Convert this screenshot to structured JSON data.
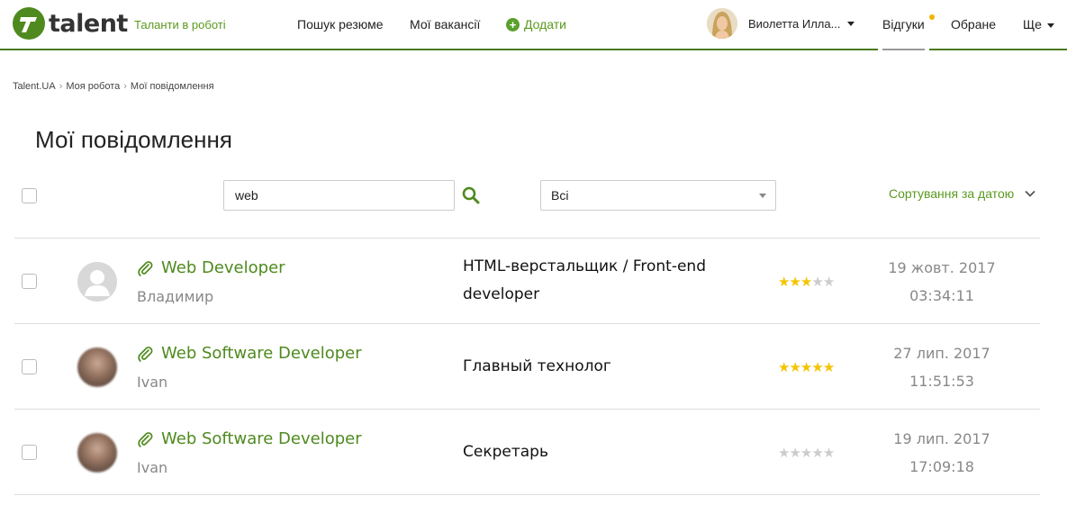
{
  "header": {
    "logo_text": "talent",
    "tagline": "Таланти в роботі",
    "nav": {
      "search_resumes": "Пошук резюме",
      "my_vacancies": "Мої вакансії",
      "add": "Додати"
    },
    "user_name": "Виолетта Илла...",
    "responses": "Відгуки",
    "favorites": "Обране",
    "more": "Ще"
  },
  "breadcrumb": [
    "Talent.UA",
    "Моя робота",
    "Мої повідомлення"
  ],
  "page_title": "Мої повідомлення",
  "toolbar": {
    "search_value": "web",
    "filter_selected": "Всі",
    "sort_label": "Сортування за датою"
  },
  "messages": [
    {
      "title": "Web Developer",
      "person": "Владимир",
      "vacancy_line1": "HTML-верстальщик / Front-end",
      "vacancy_line2": "developer",
      "rating": 3,
      "date": "19 жовт. 2017",
      "time": "03:34:11",
      "avatar": "default"
    },
    {
      "title": "Web Software Developer",
      "person": "Ivan",
      "vacancy_line1": "Главный технолог",
      "vacancy_line2": "",
      "rating": 5,
      "date": "27 лип. 2017",
      "time": "11:51:53",
      "avatar": "photo"
    },
    {
      "title": "Web Software Developer",
      "person": "Ivan",
      "vacancy_line1": "Секретарь",
      "vacancy_line2": "",
      "rating": 0,
      "date": "19 лип. 2017",
      "time": "17:09:18",
      "avatar": "photo"
    }
  ],
  "colors": {
    "brand_green": "#4e8a1e",
    "star_active": "#f5c400",
    "star_inactive": "#cccccc"
  }
}
